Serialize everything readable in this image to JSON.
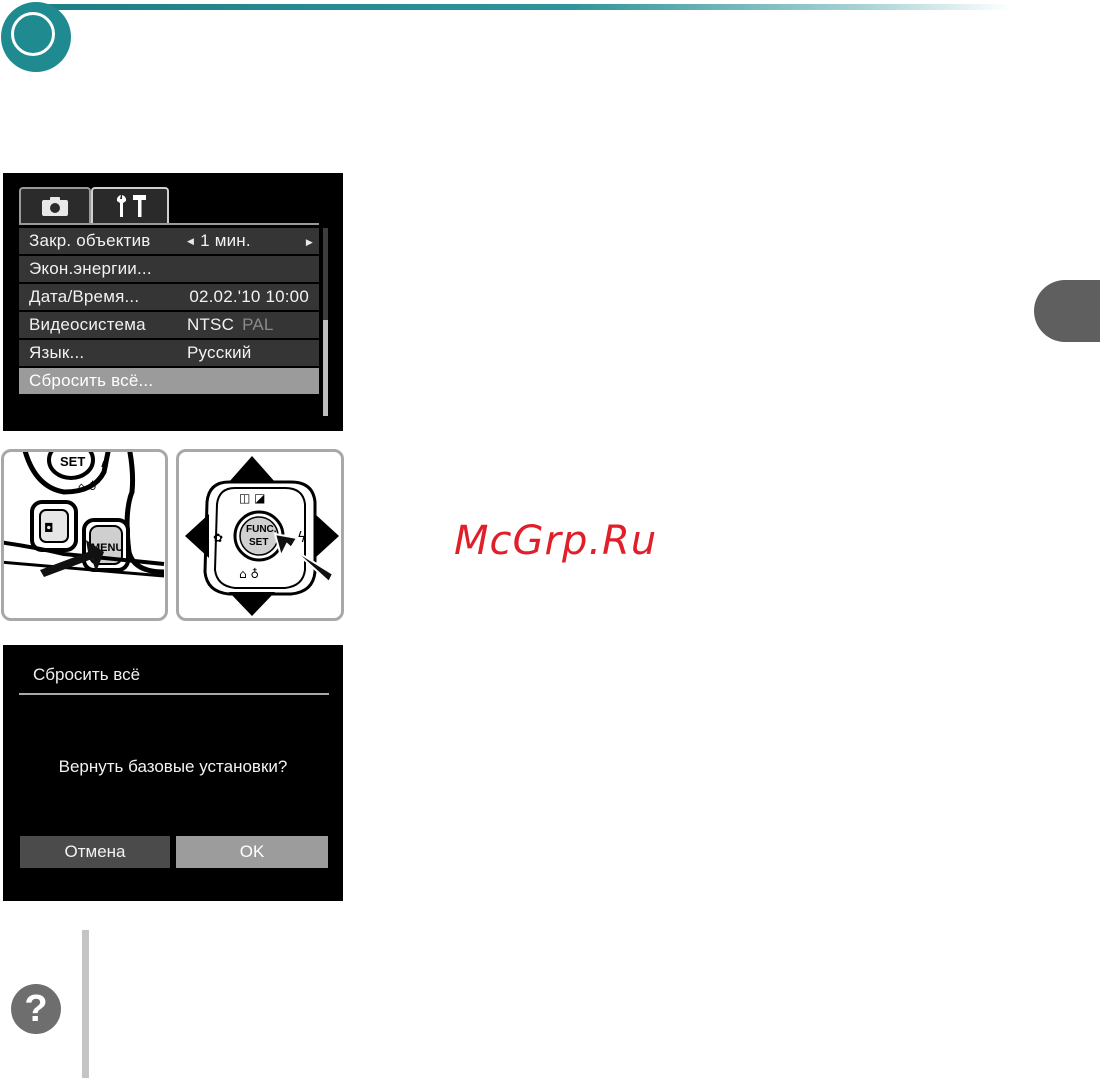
{
  "tabs": [
    {
      "name": "camera-tab",
      "icon": "camera-icon"
    },
    {
      "name": "setup-tab",
      "icon": "wrench-hammer-icon"
    }
  ],
  "menu": [
    {
      "label": "Закр. объектив",
      "value": "1 мин.",
      "arrows": true
    },
    {
      "label": "Экон.энергии...",
      "value": ""
    },
    {
      "label": "Дата/Время...",
      "value": "02.02.'10 10:00"
    },
    {
      "label": "Видеосистема",
      "value": "NTSC",
      "value_dim": "PAL"
    },
    {
      "label": "Язык...",
      "value": "Русский"
    },
    {
      "label": "Сбросить всё...",
      "value": "",
      "selected": true
    }
  ],
  "illustrations": {
    "menu_button": {
      "label": "MENU"
    },
    "func_button": {
      "label_line1": "FUNC.",
      "label_line2": "SET"
    },
    "set_label": "SET"
  },
  "dialog": {
    "title": "Сбросить всё",
    "question": "Вернуть базовые установки?",
    "cancel_label": "Отмена",
    "ok_label": "OK"
  },
  "watermark": "McGrp.Ru",
  "help_symbol": "?",
  "colors": {
    "accent_teal": "#1f8a90",
    "selected_row": "#9b9b9b",
    "watermark_red": "#e01f2a"
  }
}
